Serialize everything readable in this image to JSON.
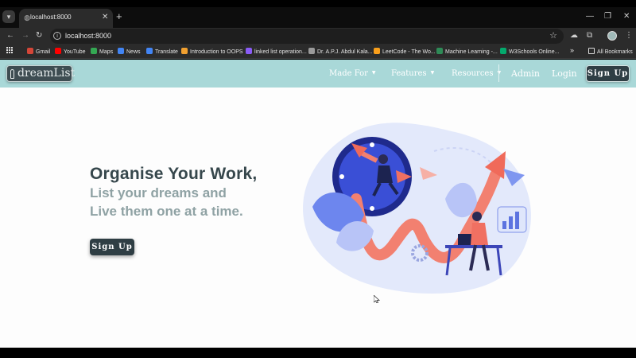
{
  "browser": {
    "tab_title": "localhost:8000",
    "url": "localhost:8000",
    "bookmarks": [
      {
        "label": "Gmail",
        "color": "#d44638"
      },
      {
        "label": "YouTube",
        "color": "#ff0000"
      },
      {
        "label": "Maps",
        "color": "#34a853"
      },
      {
        "label": "News",
        "color": "#4285f4"
      },
      {
        "label": "Translate",
        "color": "#4285f4"
      },
      {
        "label": "Introduction to OOPS",
        "color": "#f0a030"
      },
      {
        "label": "linked list operation...",
        "color": "#8a5cf6"
      },
      {
        "label": "Dr. A.P.J. Abdul Kala...",
        "color": "#9a9a9a"
      },
      {
        "label": "LeetCode - The Wo...",
        "color": "#f89f1b"
      },
      {
        "label": "Machine Learning -...",
        "color": "#2e8b57"
      },
      {
        "label": "W3Schools Online...",
        "color": "#04aa6d"
      }
    ],
    "all_bookmarks": "All Bookmarks",
    "overflow": "»"
  },
  "navbar": {
    "logo_text": "dreamList",
    "items": [
      "Made For",
      "Features",
      "Resources"
    ],
    "admin": "Admin",
    "login": "Login",
    "signup": "Sign Up"
  },
  "hero": {
    "title": "Organise Your Work,",
    "subtitle_line1": "List your dreams and",
    "subtitle_line2": "Live them one at a time.",
    "cta": "Sign Up"
  },
  "colors": {
    "navbar": "#a9d8d8",
    "button": "#2f3e44",
    "title": "#36474c",
    "subtitle": "#8fa2a4"
  }
}
